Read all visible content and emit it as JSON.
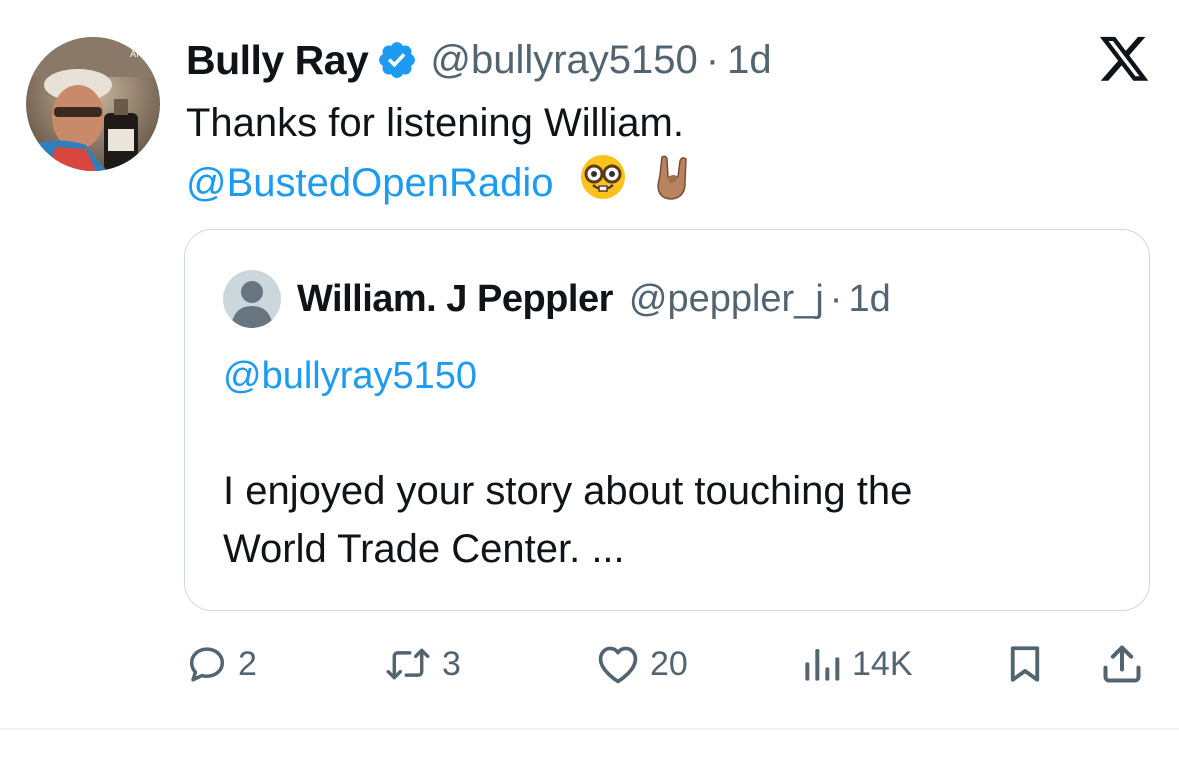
{
  "tweet": {
    "author": {
      "display_name": "Bully Ray",
      "handle": "@bullyray5150",
      "verified": true,
      "avatar_icon": "avatar-photo"
    },
    "separator": "·",
    "time": "1d",
    "text_line1": "Thanks for listening William.",
    "mention": "@BustedOpenRadio",
    "emojis": [
      "nerd-face-emoji",
      "sign-of-the-horns-emoji"
    ]
  },
  "quote": {
    "author": {
      "display_name": "William. J Peppler",
      "handle": "@peppler_j",
      "avatar_icon": "default-avatar-icon"
    },
    "separator": "·",
    "time": "1d",
    "mention": "@bullyray5150",
    "body_line1": "I enjoyed your story about touching the",
    "body_line2": "World Trade Center. ..."
  },
  "actions": {
    "reply_count": "2",
    "retweet_count": "3",
    "like_count": "20",
    "views_count": "14K"
  },
  "colors": {
    "link": "#1d9bf0",
    "secondary_text": "#536471",
    "primary_text": "#0f1419",
    "border": "#cfd9de"
  }
}
